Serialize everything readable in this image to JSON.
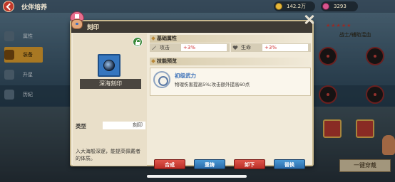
{
  "background": {
    "page_title": "伙伴培养",
    "currency": {
      "coins": "142.2万",
      "gems": "3293"
    },
    "side_menu": [
      "属性",
      "装备",
      "升星",
      "历紀"
    ],
    "job_text": "战士/辅助混血",
    "one_key_button": "一键穿戴"
  },
  "dialog": {
    "title": "刻印",
    "item_name": "深海刻印",
    "type_label": "类型",
    "type_value": "刻印",
    "description": "入大海般深邃，能提高佩戴者的体质。",
    "sections": {
      "basic": "基础属性",
      "skill": "技能预览"
    },
    "attributes": [
      {
        "name": "攻击",
        "value": "+3%",
        "icon": "sword-icon"
      },
      {
        "name": "生命",
        "value": "+3%",
        "icon": "heart-icon"
      }
    ],
    "skill": {
      "name": "初级武力",
      "description": "物理伤害提高5%;攻击额外提高60点"
    },
    "buttons": {
      "merge": "合成",
      "recast": "重铸",
      "unequip": "卸下",
      "replace": "替换"
    }
  },
  "colors": {
    "red_button": "#c9382f",
    "blue_button": "#3b84c4",
    "attr_value": "#d23b3b",
    "skill_name": "#3a70b8"
  }
}
